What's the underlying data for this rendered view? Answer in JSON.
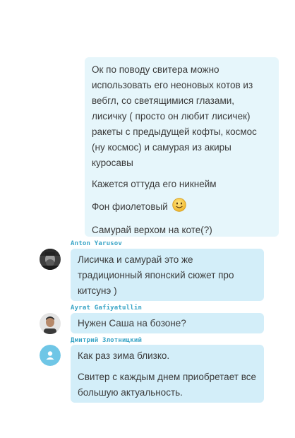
{
  "messages": [
    {
      "direction": "outgoing",
      "paragraphs": [
        "Ок по поводу свитера можно использовать его неоновых котов из вебгл, со светящимися глазами, лисичку ( просто он любит лисичек) ракеты с предыдущей кофты, космос (ну космос) и самурая из акиры куросавы",
        "Кажется оттуда его никнейм",
        "Фон фиолетовый",
        "Самурай верхом на коте(?)"
      ],
      "emoji": "slightly-smiling-face-icon"
    },
    {
      "direction": "incoming",
      "sender": "Anton Yarusov",
      "paragraphs": [
        "Лисичка и самурай это же традиционный японский сюжет про китсунэ )"
      ]
    },
    {
      "direction": "incoming",
      "sender": "Ayrat Gafiyatullin",
      "paragraphs": [
        "Нужен Саша на бозоне?"
      ]
    },
    {
      "direction": "incoming",
      "sender": "Дмитрий Злотницкий",
      "paragraphs": [
        "Как раз зима близко.",
        "Свитер с каждым днем приобретает все большую актуальность."
      ]
    }
  ],
  "colors": {
    "outgoing_bubble": "#e6f6fb",
    "incoming_bubble": "#d3eef9",
    "sender_name": "#38a4c6",
    "default_avatar": "#6fc6e6"
  }
}
